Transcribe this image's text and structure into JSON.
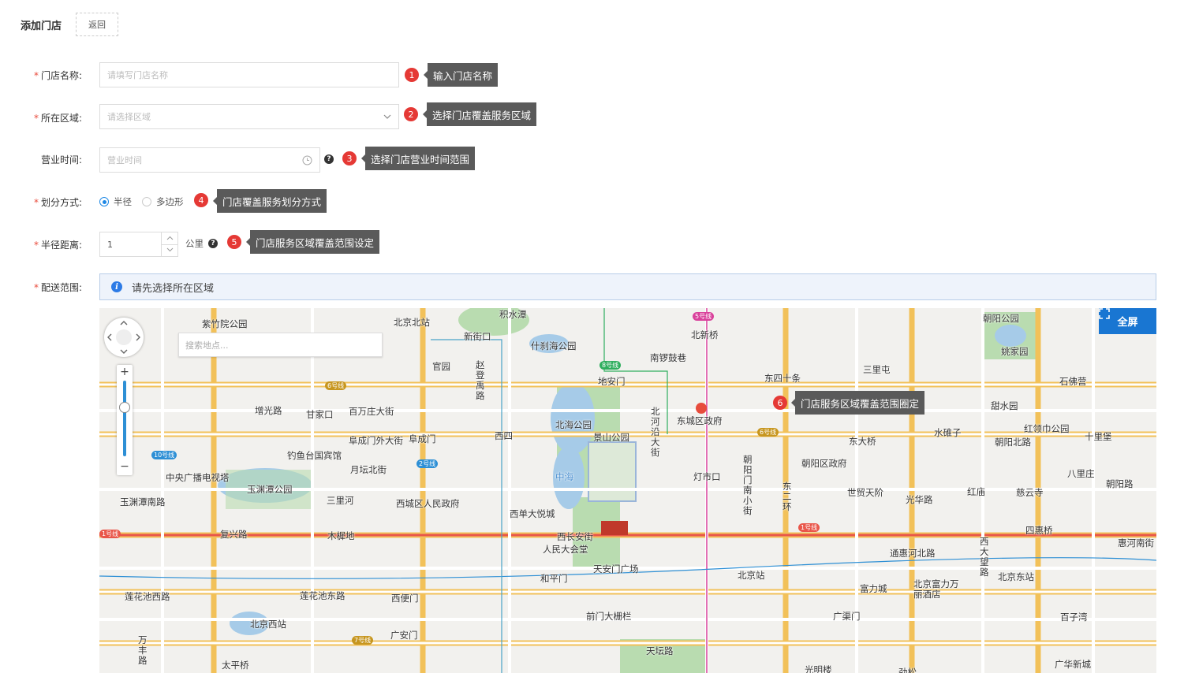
{
  "header": {
    "title": "添加门店",
    "back_label": "返回"
  },
  "form": {
    "store_name": {
      "label": "门店名称:",
      "placeholder": "请填写门店名称",
      "required": true
    },
    "region": {
      "label": "所在区域:",
      "placeholder": "请选择区域",
      "required": true
    },
    "hours": {
      "label": "营业时间:",
      "placeholder": "营业时间",
      "required": false
    },
    "division": {
      "label": "划分方式:",
      "required": true,
      "options": [
        "半径",
        "多边形"
      ],
      "selected": "半径"
    },
    "radius": {
      "label": "半径距离:",
      "value": "1",
      "unit": "公里",
      "required": true
    },
    "delivery": {
      "label": "配送范围:",
      "required": true,
      "notice": "请先选择所在区域"
    }
  },
  "tips": [
    {
      "num": "1",
      "text": "输入门店名称"
    },
    {
      "num": "2",
      "text": "选择门店覆盖服务区域"
    },
    {
      "num": "3",
      "text": "选择门店营业时间范围"
    },
    {
      "num": "4",
      "text": "门店覆盖服务划分方式"
    },
    {
      "num": "5",
      "text": "门店服务区域覆盖范围设定"
    },
    {
      "num": "6",
      "text": "门店服务区域覆盖范围圈定"
    }
  ],
  "map": {
    "fullscreen_label": "全屏",
    "search_placeholder": "搜索地点...",
    "zoom_in": "+",
    "zoom_out": "−",
    "labels": [
      "紫竹院公园",
      "北京北站",
      "积水潭",
      "新街口",
      "什刹海公园",
      "北新桥",
      "南锣鼓巷",
      "朝阳公园",
      "姚家园",
      "东四十条",
      "三里屯",
      "石佛营",
      "官园",
      "赵登禹路",
      "地安门",
      "北河沿大街",
      "东城区政府",
      "甜水园",
      "红领巾公园",
      "增光路",
      "甘家口",
      "百万庄大街",
      "北海公园",
      "景山公园",
      "阜成门外大街",
      "阜成门",
      "西四",
      "东大桥",
      "水碓子",
      "朝阳北路",
      "十里堡",
      "钓鱼台国宾馆",
      "中央广播电视塔",
      "月坛北街",
      "中海",
      "朝阳区政府",
      "八里庄",
      "玉渊潭公园",
      "灯市口",
      "世贸天阶",
      "光华路",
      "红庙",
      "慈云寺",
      "朝阳路",
      "玉渊潭南路",
      "三里河",
      "西城区人民政府",
      "西单大悦城",
      "朝阳门南小街",
      "东二环",
      "复兴路",
      "木樨地",
      "西长安街",
      "四惠桥",
      "人民大会堂",
      "通惠河北路",
      "西大望路",
      "惠河南街",
      "天安门广场",
      "北京站",
      "北京东站",
      "和平门",
      "富力城",
      "北京富力万丽酒店",
      "莲花池西路",
      "莲花池东路",
      "西便门",
      "前门大栅栏",
      "北京西站",
      "广渠门",
      "百子湾",
      "广安门",
      "天坛路",
      "广华新城",
      "万丰路",
      "太平桥",
      "光明楼",
      "劲松"
    ],
    "metro": [
      "5号线",
      "6号线",
      "8号线",
      "2号线",
      "10号线",
      "1号线",
      "7号线"
    ]
  }
}
